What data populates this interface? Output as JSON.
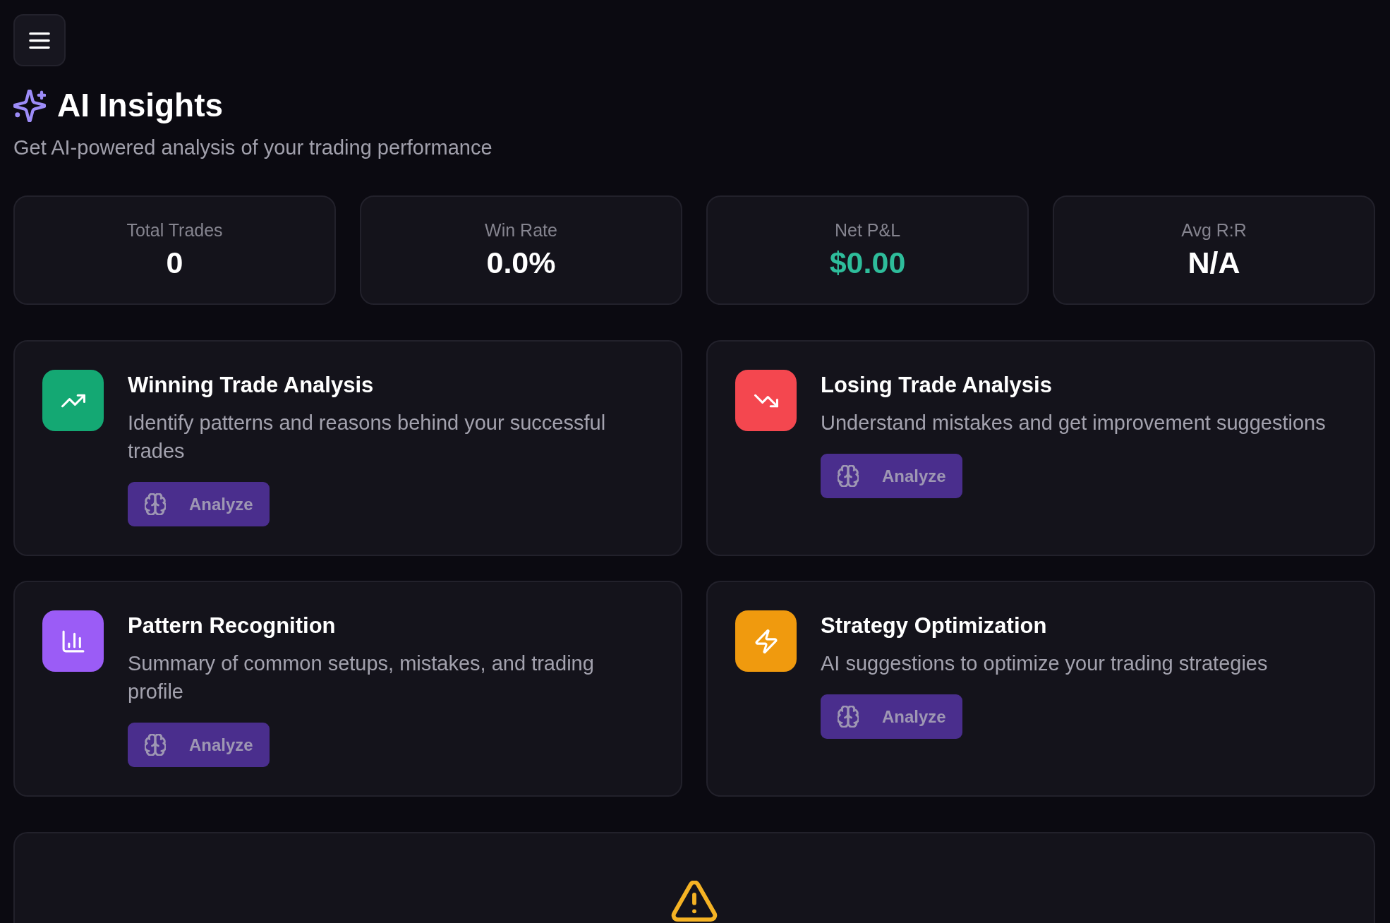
{
  "header": {
    "title": "AI Insights",
    "subtitle": "Get AI-powered analysis of your trading performance"
  },
  "stats": [
    {
      "label": "Total Trades",
      "value": "0"
    },
    {
      "label": "Win Rate",
      "value": "0.0%"
    },
    {
      "label": "Net P&L",
      "value": "$0.00",
      "color": "#2ebd9b"
    },
    {
      "label": "Avg R:R",
      "value": "N/A"
    }
  ],
  "analyses": [
    {
      "title": "Winning Trade Analysis",
      "description": "Identify patterns and reasons behind your successful trades",
      "color": "#14a873",
      "button": {
        "label": "Analyze",
        "disabled": true
      }
    },
    {
      "title": "Losing Trade Analysis",
      "description": "Understand mistakes and get improvement suggestions",
      "color": "#f4474f",
      "button": {
        "label": "Analyze",
        "disabled": true
      }
    },
    {
      "title": "Pattern Recognition",
      "description": "Summary of common setups, mistakes, and trading profile",
      "color": "#9b5cf6",
      "button": {
        "label": "Analyze",
        "disabled": true
      }
    },
    {
      "title": "Strategy Optimization",
      "description": "AI suggestions to optimize your trading strategies",
      "color": "#f09a0e",
      "button": {
        "label": "Analyze",
        "disabled": true
      }
    }
  ]
}
